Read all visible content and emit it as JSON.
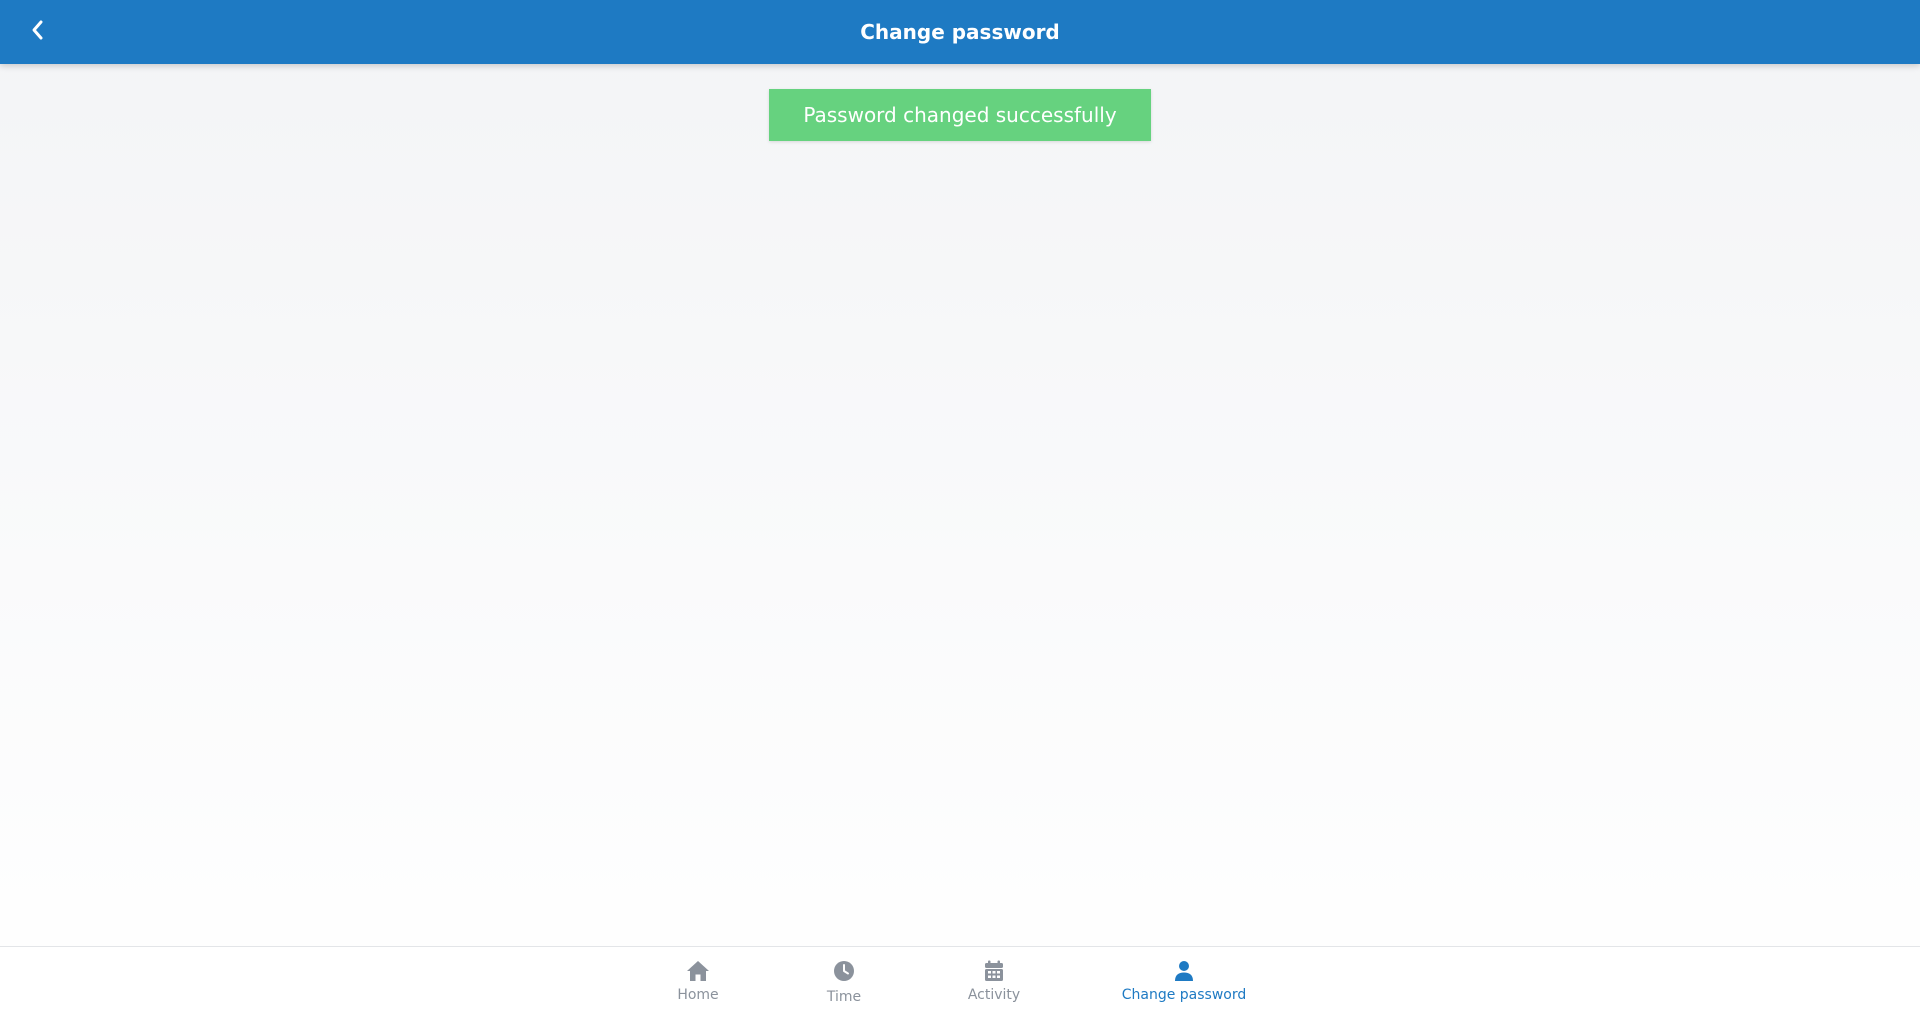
{
  "header": {
    "title": "Change password",
    "back_icon": "chevron-left-icon",
    "background_color": "#1e7ac3"
  },
  "toast": {
    "message": "Password changed successfully",
    "background_color": "#66d27f"
  },
  "bottom_nav": {
    "items": [
      {
        "label": "Home",
        "icon": "home-icon",
        "active": false
      },
      {
        "label": "Time",
        "icon": "clock-icon",
        "active": false
      },
      {
        "label": "Activity",
        "icon": "calendar-icon",
        "active": false
      },
      {
        "label": "Change password",
        "icon": "user-icon",
        "active": true
      }
    ],
    "active_color": "#1e7ac3",
    "inactive_color": "#8b929c"
  }
}
